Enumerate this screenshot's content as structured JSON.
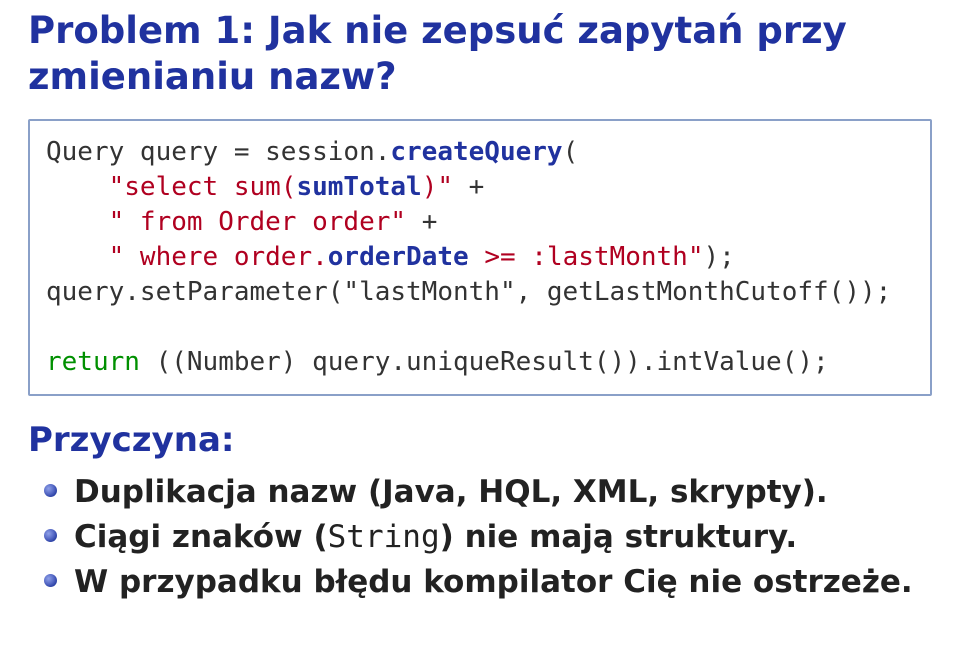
{
  "title": "Problem 1: Jak nie zepsuć zapytań przy zmienianiu nazw?",
  "code": {
    "l1_a": "Query query = session.",
    "l1_b": "createQuery",
    "l1_c": "(",
    "l2_a": "    ",
    "l2_b": "\"select sum(",
    "l2_c": "sumTotal",
    "l2_d": ")\"",
    "l2_e": " +",
    "l3_a": "    ",
    "l3_b": "\" from Order order\"",
    "l3_c": " +",
    "l4_a": "    ",
    "l4_b": "\" where order.",
    "l4_c": "orderDate",
    "l4_d": " >= :lastMonth\"",
    "l4_e": ");",
    "l5": "query.setParameter(\"lastMonth\", getLastMonthCutoff());",
    "l6": "",
    "l7_a": "return",
    "l7_b": " ((Number) query.uniqueResult()).intValue();"
  },
  "cause_heading": "Przyczyna:",
  "bullets": [
    {
      "before": "Duplikacja nazw (Java, HQL, XML, skrypty).",
      "mono": "",
      "after": ""
    },
    {
      "before": "Ciągi znaków (",
      "mono": "String",
      "after": ") nie mają struktury."
    },
    {
      "before": "W przypadku błędu kompilator Cię nie ostrzeże.",
      "mono": "",
      "after": ""
    }
  ]
}
